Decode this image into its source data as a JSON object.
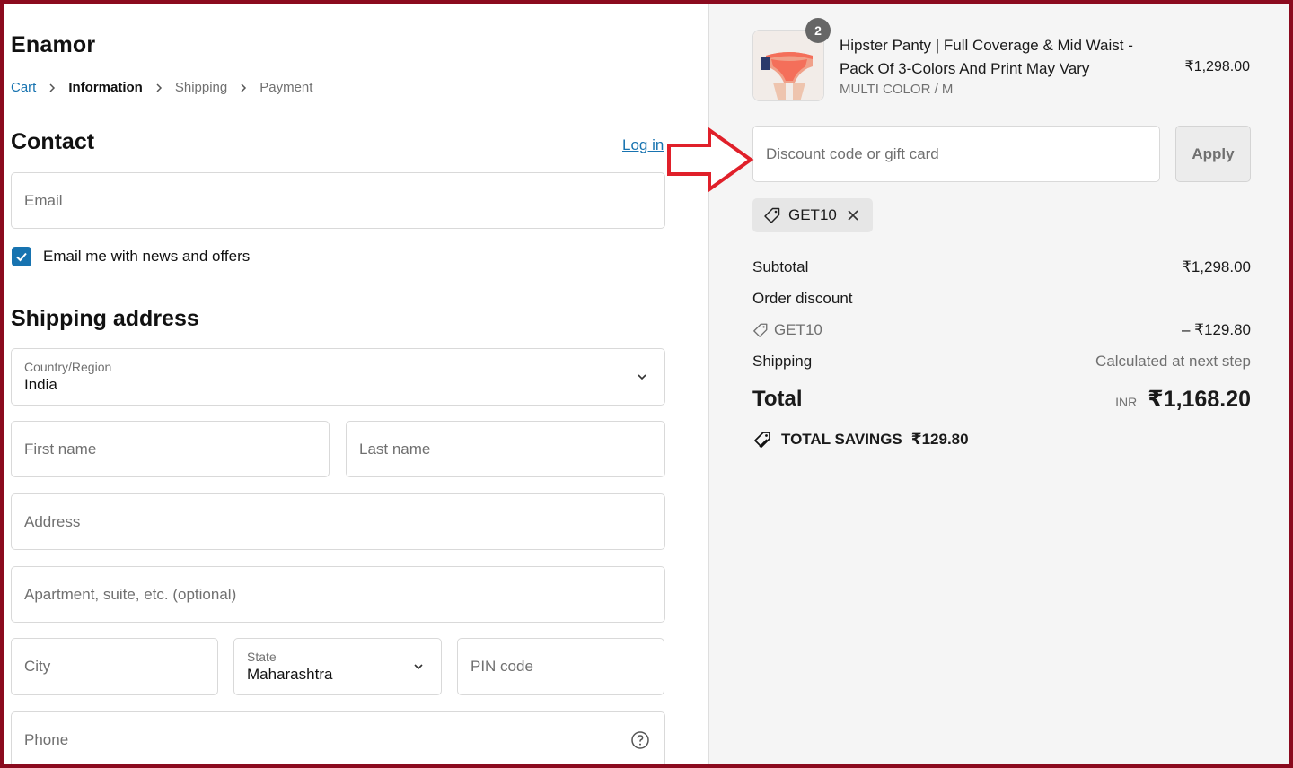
{
  "store": {
    "name": "Enamor"
  },
  "breadcrumb": [
    {
      "label": "Cart",
      "state": "link"
    },
    {
      "label": "Information",
      "state": "active"
    },
    {
      "label": "Shipping",
      "state": "inactive"
    },
    {
      "label": "Payment",
      "state": "inactive"
    }
  ],
  "contact": {
    "heading": "Contact",
    "login_label": "Log in",
    "email_placeholder": "Email",
    "newsletter_label": "Email me with news and offers",
    "newsletter_checked": true
  },
  "shipping": {
    "heading": "Shipping address",
    "country_label": "Country/Region",
    "country_value": "India",
    "first_name_placeholder": "First name",
    "last_name_placeholder": "Last name",
    "address_placeholder": "Address",
    "apartment_placeholder": "Apartment, suite, etc. (optional)",
    "city_placeholder": "City",
    "state_label": "State",
    "state_value": "Maharashtra",
    "pin_placeholder": "PIN code",
    "phone_placeholder": "Phone"
  },
  "summary": {
    "product": {
      "quantity": "2",
      "title": "Hipster Panty | Full Coverage & Mid Waist - Pack Of 3-Colors And Print May Vary",
      "variant": "MULTI COLOR / M",
      "price": "₹1,298.00"
    },
    "discount_placeholder": "Discount code or gift card",
    "apply_label": "Apply",
    "applied_code": "GET10",
    "subtotal_label": "Subtotal",
    "subtotal_value": "₹1,298.00",
    "order_discount_label": "Order discount",
    "discount_code": "GET10",
    "discount_value": "– ₹129.80",
    "shipping_label": "Shipping",
    "shipping_value": "Calculated at next step",
    "total_label": "Total",
    "total_currency": "INR",
    "total_value": "₹1,168.20",
    "savings_label": "TOTAL SAVINGS",
    "savings_value": "₹129.80"
  },
  "colors": {
    "accent": "#1773b0",
    "frame": "#8b0a1e",
    "annotation_arrow": "#e0202a"
  }
}
